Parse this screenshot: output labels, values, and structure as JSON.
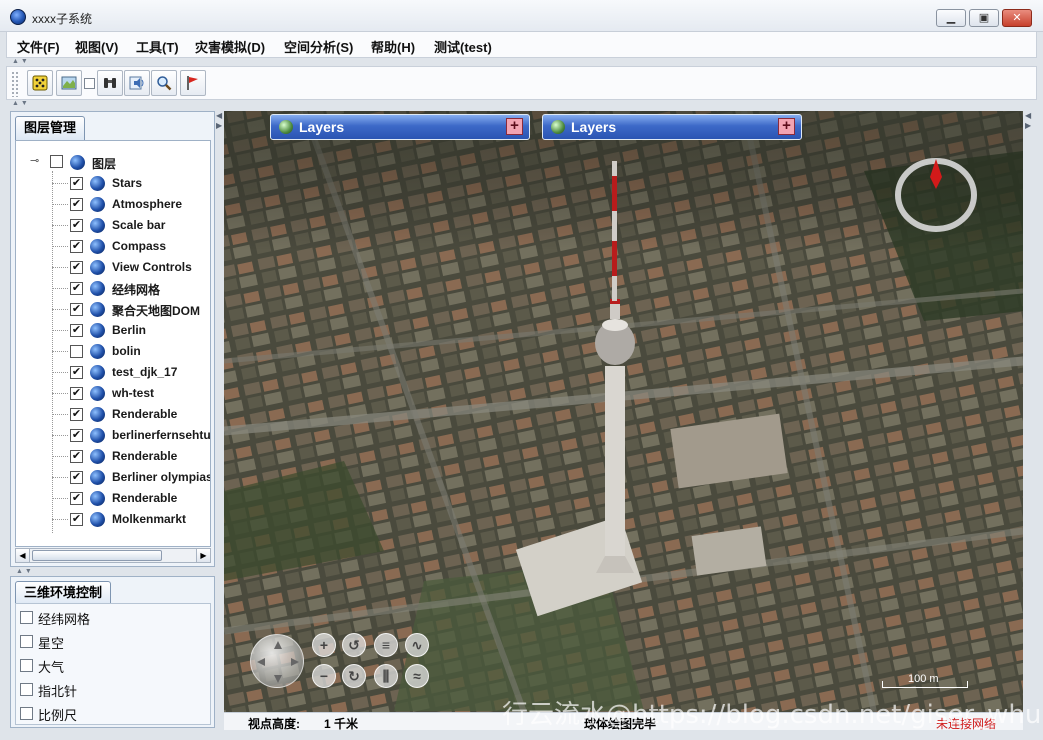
{
  "window": {
    "title": "xxxx子系统",
    "min_label": "▭",
    "max_label": "□",
    "close_label": "✕"
  },
  "menubar": {
    "items": [
      "文件(F)",
      "视图(V)",
      "工具(T)",
      "灾害模拟(D)",
      "空间分析(S)",
      "帮助(H)",
      "测试(test)"
    ]
  },
  "toolbar": {
    "buttons": [
      "dice-icon",
      "map-icon",
      "binoculars-icon",
      "speaker-icon",
      "magnifier-icon",
      "red-flag-icon"
    ]
  },
  "layers_panel": {
    "tab_label": "图层管理",
    "root": {
      "label": "图层",
      "checked": false
    },
    "layers": [
      {
        "label": "Stars",
        "checked": true
      },
      {
        "label": "Atmosphere",
        "checked": true
      },
      {
        "label": "Scale bar",
        "checked": true
      },
      {
        "label": "Compass",
        "checked": true
      },
      {
        "label": "View Controls",
        "checked": true
      },
      {
        "label": "经纬网格",
        "checked": true
      },
      {
        "label": "聚合天地图DOM",
        "checked": true
      },
      {
        "label": "Berlin",
        "checked": true
      },
      {
        "label": "bolin",
        "checked": false
      },
      {
        "label": "test_djk_17",
        "checked": true
      },
      {
        "label": "wh-test",
        "checked": true
      },
      {
        "label": "Renderable",
        "checked": true
      },
      {
        "label": "berlinerfernsehtu",
        "checked": true
      },
      {
        "label": "Renderable",
        "checked": true
      },
      {
        "label": "Berliner olympias",
        "checked": true
      },
      {
        "label": "Renderable",
        "checked": true
      },
      {
        "label": "Molkenmarkt",
        "checked": true
      }
    ]
  },
  "env_panel": {
    "tab_label": "三维环境控制",
    "items": [
      {
        "label": "经纬网格",
        "checked": false
      },
      {
        "label": "星空",
        "checked": false
      },
      {
        "label": "大气",
        "checked": false
      },
      {
        "label": "指北针",
        "checked": false
      },
      {
        "label": "比例尺",
        "checked": false
      }
    ]
  },
  "map": {
    "layers_widgets": [
      "Layers",
      "Layers"
    ],
    "scale_label": "100 m",
    "nav_buttons": {
      "zoom_in": "+",
      "zoom_out": "−",
      "rotate_cw": "↻",
      "rotate_ccw": "↺"
    }
  },
  "statusbar": {
    "altitude_label": "视点高度:",
    "altitude_value": "1 千米",
    "loading": "球体绘图完毕",
    "network": "未连接网络"
  },
  "watermark": "行云流水@https://blog.csdn.net/giser_whu"
}
